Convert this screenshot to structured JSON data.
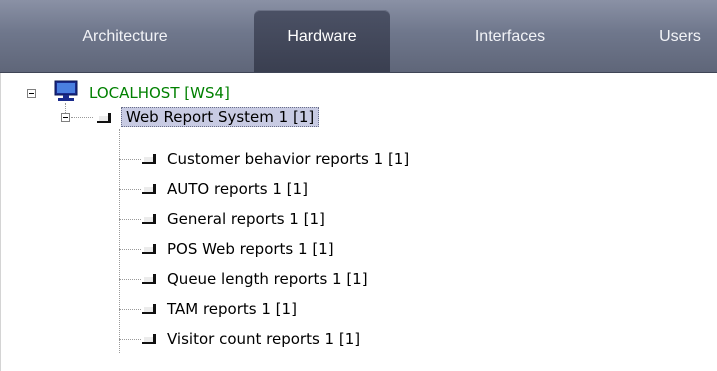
{
  "tabs": [
    {
      "label": "Architecture",
      "active": false
    },
    {
      "label": "Hardware",
      "active": true
    },
    {
      "label": "Interfaces",
      "active": false
    },
    {
      "label": "Users",
      "active": false
    }
  ],
  "tree": {
    "root": {
      "label": "LOCALHOST [WS4]",
      "icon": "computer-icon",
      "expanded": true
    },
    "system": {
      "label": "Web Report System 1 [1]",
      "icon": "module-icon",
      "expanded": true,
      "selected": true
    },
    "children": [
      {
        "label": "Customer behavior reports 1 [1]",
        "icon": "module-icon"
      },
      {
        "label": "AUTO reports 1 [1]",
        "icon": "module-icon"
      },
      {
        "label": "General reports 1 [1]",
        "icon": "module-icon"
      },
      {
        "label": "POS Web reports 1 [1]",
        "icon": "module-icon"
      },
      {
        "label": "Queue length reports 1 [1]",
        "icon": "module-icon"
      },
      {
        "label": "TAM reports 1 [1]",
        "icon": "module-icon"
      },
      {
        "label": "Visitor count reports 1 [1]",
        "icon": "module-icon"
      }
    ]
  },
  "colors": {
    "tabbar": "#6f778c",
    "active_tab": "#3f4456",
    "selection": "#c8cbe3",
    "root_text": "#008000"
  }
}
